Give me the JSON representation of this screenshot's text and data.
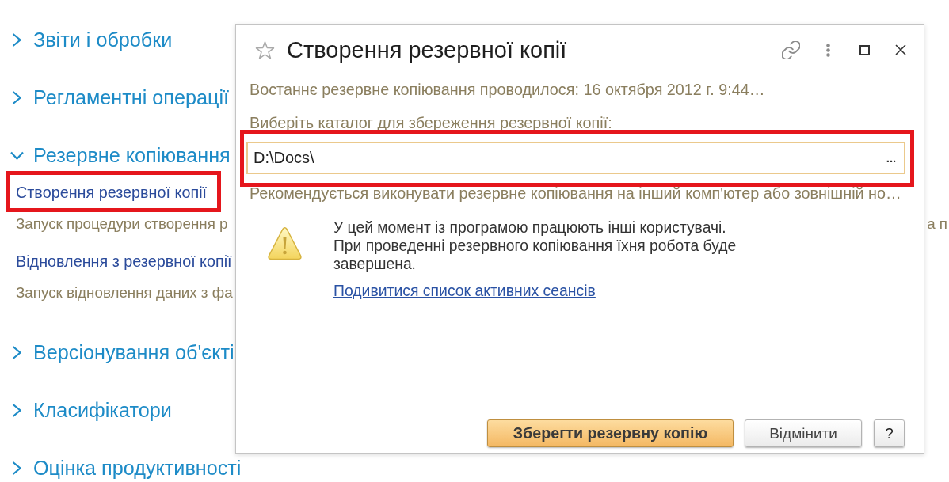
{
  "sidebar": {
    "sections": [
      {
        "title": "Звіти і обробки",
        "expanded": false
      },
      {
        "title": "Регламентні операції",
        "expanded": false
      },
      {
        "title": "Резервне копіювання",
        "expanded": true,
        "items": [
          {
            "link": "Створення резервної копії",
            "description": "Запуск процедури створення р",
            "description_tail": "а п",
            "highlighted": true
          },
          {
            "link": "Відновлення з резервної копії",
            "description": "Запуск відновлення даних з фа",
            "highlighted": false
          }
        ]
      },
      {
        "title": "Версіонування об'єкті",
        "expanded": false
      },
      {
        "title": "Класифікатори",
        "expanded": false
      },
      {
        "title": "Оцінка продуктивності",
        "expanded": false
      }
    ]
  },
  "dialog": {
    "title": "Створення резервної копії",
    "last_backup": "Востаннє резервне копіювання проводилося: 16 октября 2012 г. 9:44…",
    "folder_label": "Виберіть каталог для збереження резервної копії:",
    "folder_field": {
      "value": "D:\\Docs\\",
      "choose_button": "...",
      "highlighted": true
    },
    "hint": "Рекомендується виконувати резервне копіювання на інший комп'ютер або зовнішній но…",
    "warning": {
      "lines": [
        "У цей момент із програмою працюють інші користувачі.",
        "При проведенні резервного копіювання їхня робота буде завершена."
      ],
      "link": "Подивитися список активних сеансів"
    },
    "buttons": [
      {
        "label": "Зберегти резервну копію",
        "kind": "primary"
      },
      {
        "label": "Відмінити",
        "kind": "secondary"
      },
      {
        "label": "?",
        "kind": "help"
      }
    ]
  }
}
